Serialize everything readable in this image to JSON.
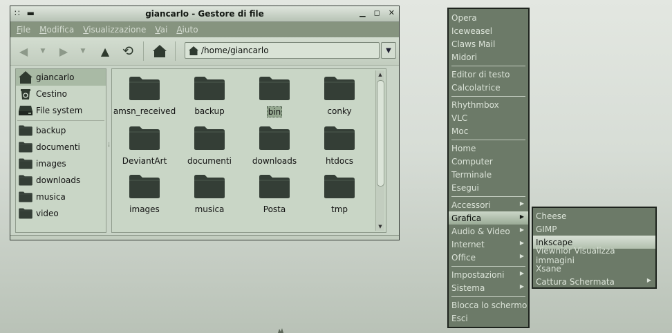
{
  "window": {
    "title": "giancarlo - Gestore di file",
    "menus": [
      "File",
      "Modifica",
      "Visualizzazione",
      "Vai",
      "Aiuto"
    ],
    "location": "/home/giancarlo"
  },
  "sidebar": [
    {
      "label": "giancarlo",
      "icon": "home-icon"
    },
    {
      "label": "Cestino",
      "icon": "trash-icon"
    },
    {
      "label": "File system",
      "icon": "drive-icon"
    },
    {
      "label": "backup",
      "icon": "folder-icon"
    },
    {
      "label": "documenti",
      "icon": "folder-icon"
    },
    {
      "label": "images",
      "icon": "folder-icon"
    },
    {
      "label": "downloads",
      "icon": "folder-icon"
    },
    {
      "label": "musica",
      "icon": "folder-icon"
    },
    {
      "label": "video",
      "icon": "folder-icon"
    }
  ],
  "files": [
    "amsn_received",
    "backup",
    "bin",
    "conky",
    "DeviantArt",
    "documenti",
    "downloads",
    "htdocs",
    "images",
    "musica",
    "Posta",
    "tmp"
  ],
  "selected_file": "bin",
  "app_menu": {
    "groups": [
      [
        "Opera",
        "Iceweasel",
        "Claws Mail",
        "Midori"
      ],
      [
        "Editor di testo",
        "Calcolatrice"
      ],
      [
        "Rhythmbox",
        "VLC",
        "Moc"
      ],
      [
        "Home",
        "Computer",
        "Terminale",
        "Esegui"
      ],
      [
        "Accessori",
        "Grafica",
        "Audio & Video",
        "Internet",
        "Office"
      ],
      [
        "Impostazioni",
        "Sistema"
      ],
      [
        "Blocca lo schermo",
        "Esci"
      ]
    ],
    "submenu_items": [
      "Accessori",
      "Grafica",
      "Audio & Video",
      "Internet",
      "Office",
      "Impostazioni",
      "Sistema"
    ],
    "selected": "Grafica"
  },
  "submenu": {
    "items": [
      "Cheese",
      "GIMP",
      "Inkscape",
      "Viewnior Visualizza immagini",
      "Xsane",
      "Cattura Schermata"
    ],
    "selected": "Inkscape",
    "has_arrow": [
      "Cattura Schermata"
    ]
  },
  "colors": {
    "menu_bg": "#6c7a68",
    "folder": "#343e36",
    "window_bg": "#c9d4c7"
  }
}
